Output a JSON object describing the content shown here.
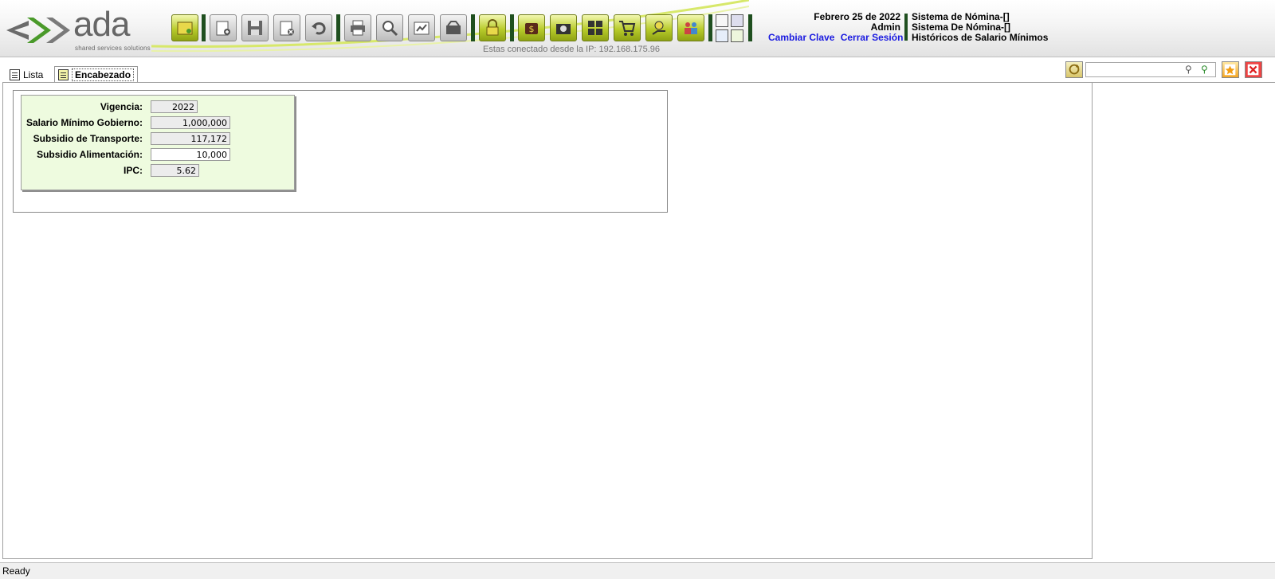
{
  "brand": {
    "name": "ada",
    "tagline": "shared services solutions"
  },
  "toolbar": {
    "buttons": [
      {
        "name": "open-folder",
        "style": "green"
      },
      {
        "name": "new-record",
        "style": "gray"
      },
      {
        "name": "save",
        "style": "gray"
      },
      {
        "name": "delete",
        "style": "gray"
      },
      {
        "name": "undo",
        "style": "gray"
      },
      {
        "name": "print",
        "style": "gray"
      },
      {
        "name": "search",
        "style": "gray"
      },
      {
        "name": "export",
        "style": "gray"
      },
      {
        "name": "tools",
        "style": "gray"
      },
      {
        "name": "lock",
        "style": "green"
      },
      {
        "name": "money",
        "style": "green"
      },
      {
        "name": "camera",
        "style": "green"
      },
      {
        "name": "grid",
        "style": "green"
      },
      {
        "name": "cart",
        "style": "green"
      },
      {
        "name": "hand",
        "style": "green"
      },
      {
        "name": "users",
        "style": "green"
      }
    ],
    "connection_text": "Estas conectado desde la IP: 192.168.175.96"
  },
  "session": {
    "date": "Febrero 25 de 2022",
    "user": "Admin",
    "change_password": "Cambiar Clave",
    "logout": "Cerrar Sesión"
  },
  "context": {
    "line1": "Sistema de Nómina-[]",
    "line2": "Sistema De Nómina-[]",
    "line3": "Históricos de Salario Mínimos"
  },
  "tabs": {
    "lista": "Lista",
    "encabezado": "Encabezado",
    "active": "encabezado"
  },
  "form": {
    "vigencia_label": "Vigencia:",
    "vigencia_value": "2022",
    "salario_label": "Salario Mínimo Gobierno:",
    "salario_value": "1,000,000",
    "transporte_label": "Subsidio de Transporte:",
    "transporte_value": "117,172",
    "alimentacion_label": "Subsidio Alimentación:",
    "alimentacion_value": "10,000",
    "ipc_label": "IPC:",
    "ipc_value": "5.62"
  },
  "search": {
    "value": ""
  },
  "status": {
    "text": "Ready"
  },
  "colors": {
    "accent_green": "#b9cc2c",
    "dark_green_separator": "#1f4f1f",
    "link_blue": "#1a1ae0",
    "form_background": "#eefbdf"
  }
}
